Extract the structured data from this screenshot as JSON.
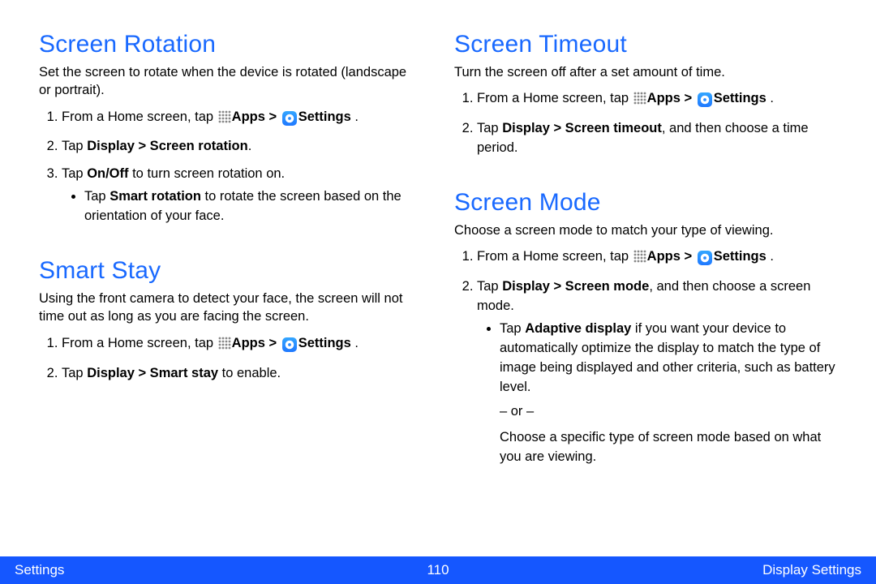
{
  "footer": {
    "left": "Settings",
    "page": "110",
    "right": "Display Settings"
  },
  "icons": {
    "apps": "apps-grid-icon",
    "settings": "settings-gear-icon"
  },
  "left": {
    "rotation": {
      "title": "Screen Rotation",
      "desc": "Set the screen to rotate when the device is rotated (landscape or portrait).",
      "step1_prefix": "From a Home screen, tap ",
      "apps_label": "Apps",
      "gt": " > ",
      "settings_label": "Settings",
      "step1_suffix": " .",
      "step2_pre": "Tap ",
      "step2_bold": "Display > Screen rotation",
      "step2_post": ".",
      "step3_pre": "Tap ",
      "step3_bold": "On/Off",
      "step3_post": " to turn screen rotation on.",
      "bullet_pre": "Tap ",
      "bullet_bold": "Smart rotation",
      "bullet_post": " to rotate the screen based on the orientation of your face."
    },
    "smartstay": {
      "title": "Smart Stay",
      "desc": "Using the front camera to detect your face, the screen will not time out as long as you are facing the screen.",
      "step1_prefix": "From a Home screen, tap ",
      "apps_label": "Apps",
      "gt": " > ",
      "settings_label": "Settings",
      "step1_suffix": " .",
      "step2_pre": "Tap ",
      "step2_bold": "Display > Smart stay",
      "step2_post": " to enable."
    }
  },
  "right": {
    "timeout": {
      "title": "Screen Timeout",
      "desc": "Turn the screen off after a set amount of time.",
      "step1_prefix": "From a Home screen, tap ",
      "apps_label": "Apps",
      "gt": " > ",
      "settings_label": "Settings",
      "step1_suffix": " .",
      "step2_pre": "Tap ",
      "step2_bold": "Display > Screen timeout",
      "step2_post": ", and then choose a time period."
    },
    "mode": {
      "title": "Screen Mode",
      "desc": "Choose a screen mode to match your type of viewing.",
      "step1_prefix": "From a Home screen, tap ",
      "apps_label": "Apps",
      "gt": " > ",
      "settings_label": "Settings",
      "step1_suffix": " .",
      "step2_pre": "Tap ",
      "step2_bold": "Display > Screen mode",
      "step2_post": ", and then choose a screen mode.",
      "bullet_pre": "Tap ",
      "bullet_bold": "Adaptive display",
      "bullet_post": " if you want your device to automatically optimize the display to match the type of image being displayed and other criteria, such as battery level.",
      "or": "– or –",
      "after": "Choose a specific type of screen mode based on what you are viewing."
    }
  }
}
